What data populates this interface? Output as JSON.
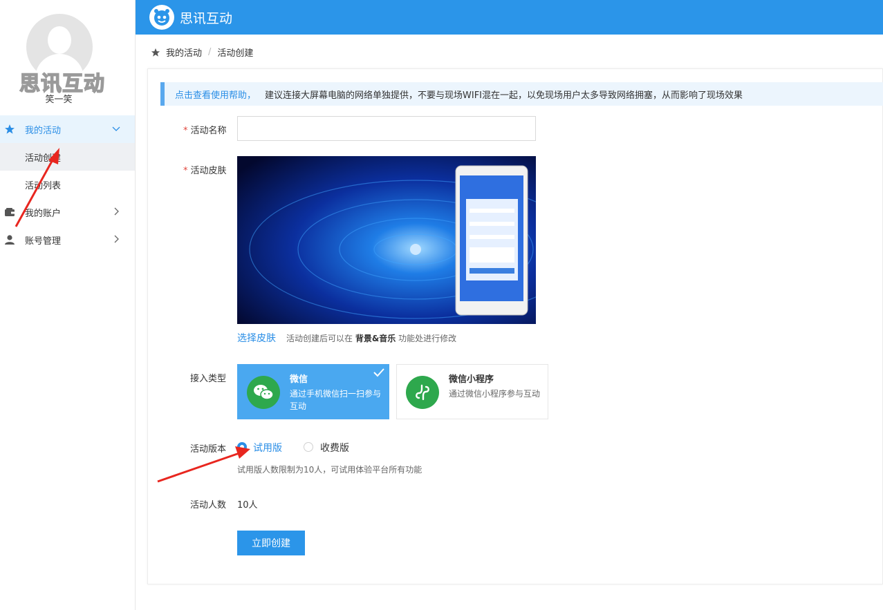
{
  "header": {
    "app_title": "思讯互动",
    "brand_color": "#2b95e9"
  },
  "sidebar": {
    "watermark": "思讯互动",
    "username": "笑一笑",
    "items": [
      {
        "label": "我的活动",
        "icon": "star-icon",
        "expanded": true
      },
      {
        "label": "活动创建",
        "selected": true
      },
      {
        "label": "活动列表"
      },
      {
        "label": "我的账户",
        "icon": "wallet-icon"
      },
      {
        "label": "账号管理",
        "icon": "user-icon"
      }
    ]
  },
  "breadcrumb": {
    "home": "我的活动",
    "separator": "/",
    "current": "活动创建",
    "icon": "home-star-icon"
  },
  "notice": {
    "link": "点击查看使用帮助，",
    "text": "建议连接大屏幕电脑的网络单独提供，不要与现场WIFI混在一起，以免现场用户太多导致网络拥塞，从而影响了现场效果"
  },
  "form": {
    "required_mark": "*",
    "name_label": "活动名称",
    "name_value": "",
    "skin_label": "活动皮肤",
    "choose_skin": "选择皮肤",
    "skin_hint_pre": "活动创建后可以在",
    "skin_hint_bold": "背景&音乐",
    "skin_hint_post": "功能处进行修改",
    "type_label": "接入类型",
    "types": [
      {
        "title": "微信",
        "desc": "通过手机微信扫一扫参与互动",
        "icon": "wechat-icon",
        "selected": true
      },
      {
        "title": "微信小程序",
        "desc": "通过微信小程序参与互动",
        "icon": "mini-program-icon",
        "selected": false
      }
    ],
    "version_label": "活动版本",
    "versions": [
      {
        "label": "试用版",
        "selected": true
      },
      {
        "label": "收费版",
        "selected": false
      }
    ],
    "version_hint": "试用版人数限制为10人，可试用体验平台所有功能",
    "count_label": "活动人数",
    "count_value": "10人",
    "submit": "立即创建"
  },
  "colors": {
    "accent": "#2a8ee6",
    "active_card": "#4aa8f0",
    "wechat_green": "#2ea84d",
    "annotation_red": "#e8261f"
  }
}
